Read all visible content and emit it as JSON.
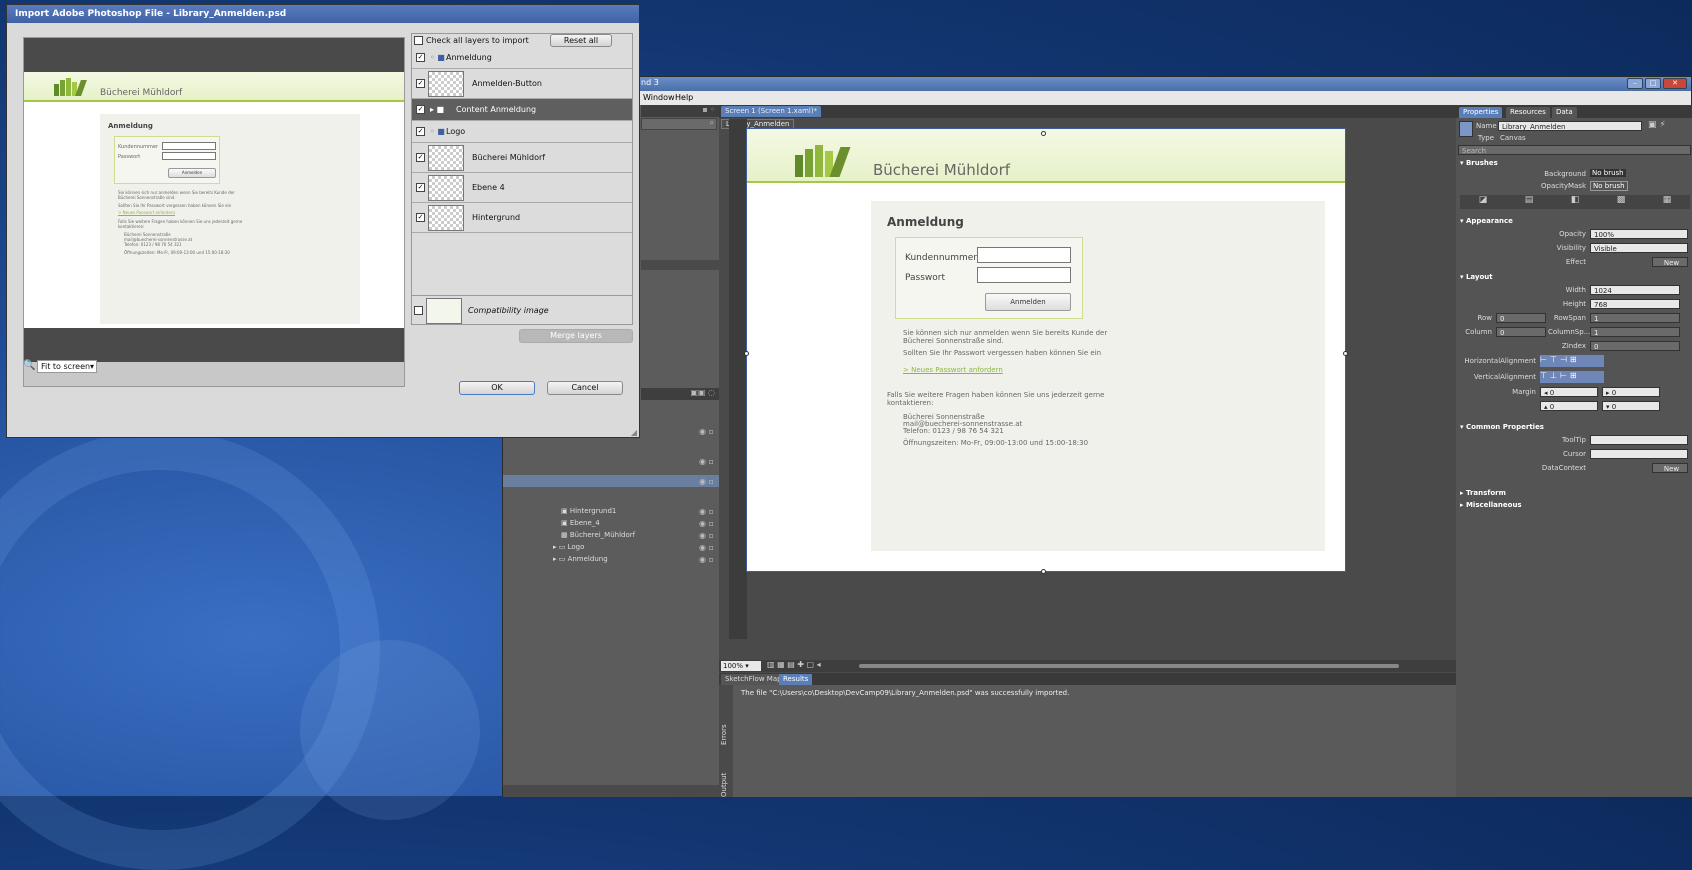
{
  "blend": {
    "title_fragment": "nd 3",
    "menu": [
      "Window",
      "Help"
    ],
    "tabs": {
      "screen": "Screen 1 (Screen 1.xaml)*",
      "breadcrumb": "Library_Anmelden"
    },
    "objects": [
      {
        "label": "Hintergrund1"
      },
      {
        "label": "Ebene_4"
      },
      {
        "label": "Bücherei_Mühldorf"
      },
      {
        "label": "Logo"
      },
      {
        "label": "Anmeldung"
      }
    ],
    "zoom": "100%",
    "bottom_tabs": [
      "SketchFlow Map",
      "Results"
    ],
    "result_message": "The file \"C:\\Users\\co\\Desktop\\DevCamp09\\Library_Anmelden.psd\" was successfully imported.",
    "side_tabs": [
      "Errors",
      "Output"
    ],
    "properties": {
      "tabs": [
        "Properties",
        "Resources",
        "Data"
      ],
      "name_label": "Name",
      "name_value": "Library_Anmelden",
      "type_label": "Type",
      "type_value": "Canvas",
      "search_placeholder": "Search",
      "brushes": {
        "title": "Brushes",
        "background_label": "Background",
        "background_value": "No brush",
        "opacitymask_label": "OpacityMask",
        "opacitymask_value": "No brush"
      },
      "appearance": {
        "title": "Appearance",
        "opacity_label": "Opacity",
        "opacity_value": "100%",
        "visibility_label": "Visibility",
        "visibility_value": "Visible",
        "effect_label": "Effect",
        "effect_button": "New"
      },
      "layout": {
        "title": "Layout",
        "width_label": "Width",
        "width_value": "1024",
        "height_label": "Height",
        "height_value": "768",
        "row_label": "Row",
        "row_value": "0",
        "rowspan_label": "RowSpan",
        "rowspan_value": "1",
        "column_label": "Column",
        "column_value": "0",
        "columnspan_label": "ColumnSp...",
        "columnspan_value": "1",
        "zindex_label": "ZIndex",
        "zindex_value": "0",
        "halign_label": "HorizontalAlignment",
        "valign_label": "VerticalAlignment",
        "margin_label": "Margin",
        "margin_values": [
          "0",
          "0",
          "0",
          "0"
        ]
      },
      "common": {
        "title": "Common Properties",
        "tooltip_label": "ToolTip",
        "cursor_label": "Cursor",
        "datacontext_label": "DataContext",
        "datacontext_button": "New"
      },
      "transform": "Transform",
      "misc": "Miscellaneous"
    }
  },
  "site": {
    "brand": "Bücherei Mühldorf",
    "heading": "Anmeldung",
    "user_label": "Kundennummer",
    "pass_label": "Passwort",
    "login_button": "Anmelden",
    "p1a": "Sie können sich nur anmelden wenn Sie bereits Kunde der",
    "p1b": "Bücherei Sonnenstraße sind.",
    "p2": "Sollten Sie Ihr Passwort vergessen haben können Sie ein",
    "link": "> Neues Passwort anfordern",
    "p3a": "Falls Sie weitere Fragen haben können Sie uns jederzeit gerne",
    "p3b": "kontaktieren:",
    "addr1": "Bücherei Sonnenstraße",
    "addr2": "mail@buecherei-sonnenstrasse.at",
    "addr3": "Telefon: 0123 / 98 76 54 321",
    "hours": "Öffnungszeiten: Mo-Fr, 09:00-13:00 und 15:00-18:30"
  },
  "dialog": {
    "title": "Import Adobe Photoshop File - Library_Anmelden.psd",
    "check_all": "Check all layers to import",
    "reset_all": "Reset all",
    "layers": [
      {
        "name": "Anmeldung",
        "checked": true,
        "kind": "group"
      },
      {
        "name": "Anmelden-Button",
        "checked": true,
        "kind": "layer"
      },
      {
        "name": "Content Anmeldung",
        "checked": true,
        "kind": "group-selected"
      },
      {
        "name": "Logo",
        "checked": true,
        "kind": "group"
      },
      {
        "name": "Bücherei Mühldorf",
        "checked": true,
        "kind": "layer"
      },
      {
        "name": "Ebene 4",
        "checked": true,
        "kind": "layer"
      },
      {
        "name": "Hintergrund",
        "checked": true,
        "kind": "layer"
      }
    ],
    "compat": "Compatibility image",
    "merge": "Merge layers",
    "fit": "Fit to screen",
    "ok": "OK",
    "cancel": "Cancel"
  }
}
